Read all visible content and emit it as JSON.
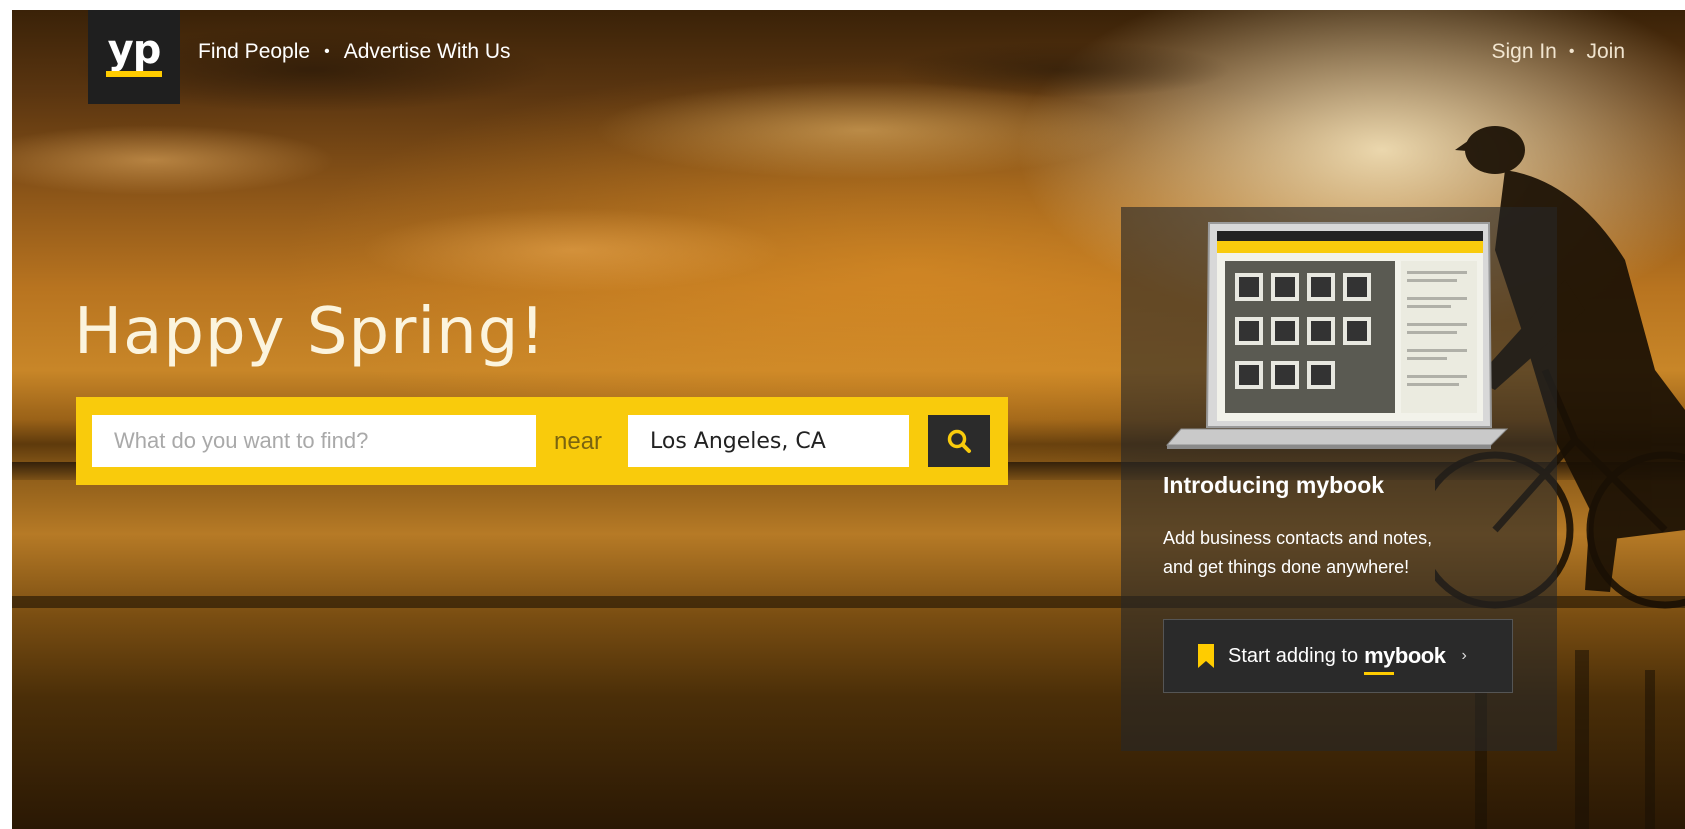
{
  "brand": {
    "logo_text": "yp",
    "accent": "#ffcc00",
    "dark": "#1f1f1f"
  },
  "header": {
    "nav_left": [
      "Find People",
      "Advertise With Us"
    ],
    "nav_right": [
      "Sign In",
      "Join"
    ],
    "separator": "•"
  },
  "hero": {
    "headline": "Happy Spring!",
    "search": {
      "what_placeholder": "What do you want to find?",
      "what_value": "",
      "near_label": "near",
      "location_value": "Los Angeles, CA",
      "button_icon": "search-icon",
      "bar_color": "#f9cb0c"
    }
  },
  "promo": {
    "title": "Introducing mybook",
    "description_lines": [
      "Add business contacts and notes,",
      "and get things done anywhere!"
    ],
    "button": {
      "prefix": "Start adding to",
      "brand_word": "mybook",
      "icon": "bookmark-icon",
      "chevron": "›"
    }
  }
}
